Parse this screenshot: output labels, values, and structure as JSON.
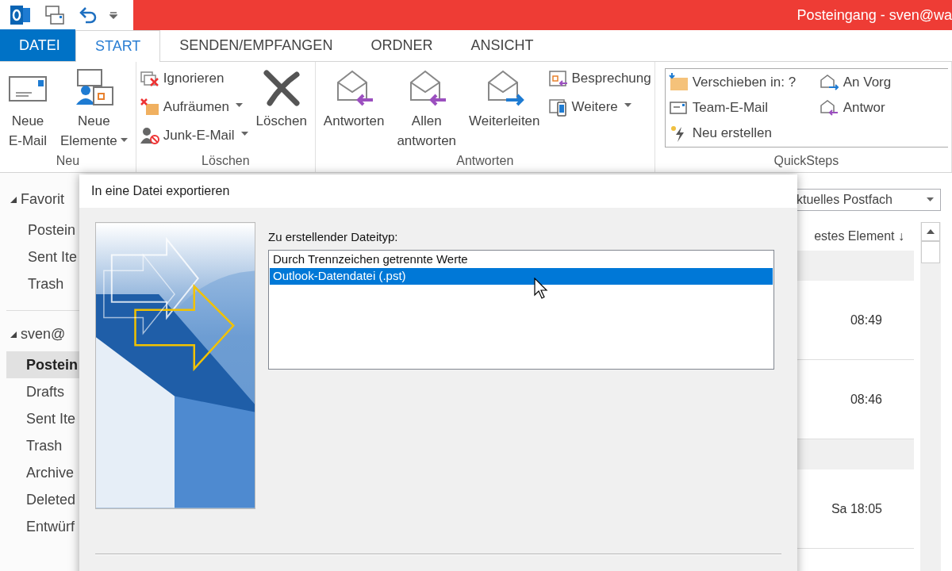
{
  "title_bar": {
    "title": "Posteingang - sven@wa"
  },
  "tabs": [
    {
      "label": "DATEI",
      "kind": "file",
      "selected": false
    },
    {
      "label": "START",
      "kind": "tab",
      "selected": true
    },
    {
      "label": "SENDEN/EMPFANGEN",
      "kind": "tab",
      "selected": false
    },
    {
      "label": "ORDNER",
      "kind": "tab",
      "selected": false
    },
    {
      "label": "ANSICHT",
      "kind": "tab",
      "selected": false
    }
  ],
  "ribbon": {
    "groups": [
      {
        "label": "Neu",
        "items": [
          {
            "kind": "large",
            "lines": [
              "Neue",
              "E-Mail"
            ],
            "has_menu": false
          },
          {
            "kind": "large",
            "lines": [
              "Neue",
              "Elemente"
            ],
            "has_menu": true
          }
        ]
      },
      {
        "label": "Löschen",
        "items": [
          {
            "kind": "stack",
            "entries": [
              {
                "label": "Ignorieren",
                "has_menu": false
              },
              {
                "label": "Aufräumen",
                "has_menu": true
              },
              {
                "label": "Junk-E-Mail",
                "has_menu": true
              }
            ]
          },
          {
            "kind": "large",
            "lines": [
              "Löschen"
            ],
            "has_menu": false
          }
        ]
      },
      {
        "label": "Antworten",
        "items": [
          {
            "kind": "large",
            "lines": [
              "Antworten"
            ],
            "has_menu": false
          },
          {
            "kind": "large",
            "lines": [
              "Allen",
              "antworten"
            ],
            "has_menu": false
          },
          {
            "kind": "large",
            "lines": [
              "Weiterleiten"
            ],
            "has_menu": false
          },
          {
            "kind": "stack",
            "entries": [
              {
                "label": "Besprechung",
                "has_menu": false
              },
              {
                "label": "Weitere",
                "has_menu": true
              }
            ]
          }
        ]
      },
      {
        "label": "QuickSteps",
        "items": [
          {
            "kind": "quicksteps",
            "entries": [
              {
                "label": "Verschieben in: ?"
              },
              {
                "label": "An Vorg"
              },
              {
                "label": "Team-E-Mail"
              },
              {
                "label": "Antwor"
              },
              {
                "label": "Neu erstellen"
              }
            ]
          }
        ]
      }
    ]
  },
  "sidebar": {
    "sections": [
      {
        "label": "Favorit",
        "expanded": true,
        "items": [
          {
            "label": "Postein",
            "selected": false
          },
          {
            "label": "Sent Ite",
            "selected": false
          },
          {
            "label": "Trash",
            "selected": false
          }
        ]
      },
      {
        "label": "sven@",
        "expanded": true,
        "items": [
          {
            "label": "Postein",
            "selected": true
          },
          {
            "label": "Drafts",
            "selected": false
          },
          {
            "label": "Sent Ite",
            "selected": false
          },
          {
            "label": "Trash",
            "selected": false
          },
          {
            "label": "Archive",
            "selected": false
          },
          {
            "label": "Deleted",
            "selected": false
          },
          {
            "label": "Entwürf",
            "selected": false
          }
        ]
      }
    ]
  },
  "message_list": {
    "scope": "ktuelles Postfach",
    "sort_header": "estes Element ↓",
    "rows": [
      {
        "kind": "group"
      },
      {
        "kind": "message",
        "time": "08:49"
      },
      {
        "kind": "message",
        "time": "08:46"
      },
      {
        "kind": "group"
      },
      {
        "kind": "message",
        "time": "Sa 18:05"
      }
    ]
  },
  "dialog": {
    "title": "In eine Datei exportieren",
    "label": "Zu erstellender Dateityp:",
    "file_types": [
      {
        "label": "Durch Trennzeichen getrennte Werte",
        "selected": false
      },
      {
        "label": "Outlook-Datendatei (.pst)",
        "selected": true
      }
    ]
  }
}
